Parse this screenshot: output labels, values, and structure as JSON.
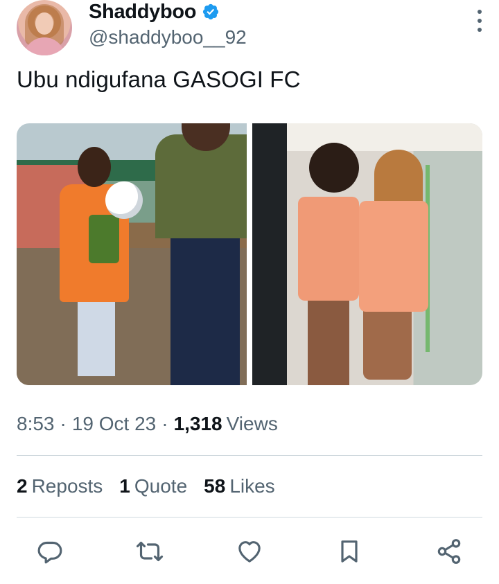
{
  "author": {
    "display_name": "Shaddyboo",
    "handle": "@shaddyboo__92",
    "verified_icon": "verified-badge-icon",
    "avatar": "profile-avatar"
  },
  "tweet": {
    "text": "Ubu ndigufana GASOGI FC",
    "media": [
      {
        "name": "photo-boy-and-man-with-ball"
      },
      {
        "name": "photo-two-women-in-towels"
      }
    ]
  },
  "meta": {
    "time": "8:53",
    "separator": "·",
    "date": "19 Oct 23",
    "views_count": "1,318",
    "views_label": "Views"
  },
  "stats": {
    "reposts_count": "2",
    "reposts_label": "Reposts",
    "quotes_count": "1",
    "quotes_label": "Quote",
    "likes_count": "58",
    "likes_label": "Likes"
  },
  "actions": {
    "reply_icon": "reply-icon",
    "repost_icon": "repost-icon",
    "like_icon": "heart-icon",
    "bookmark_icon": "bookmark-icon",
    "share_icon": "share-icon"
  },
  "colors": {
    "text_primary": "#0f1419",
    "text_secondary": "#536471",
    "accent": "#1d9bf0",
    "divider": "#cfd9de"
  }
}
